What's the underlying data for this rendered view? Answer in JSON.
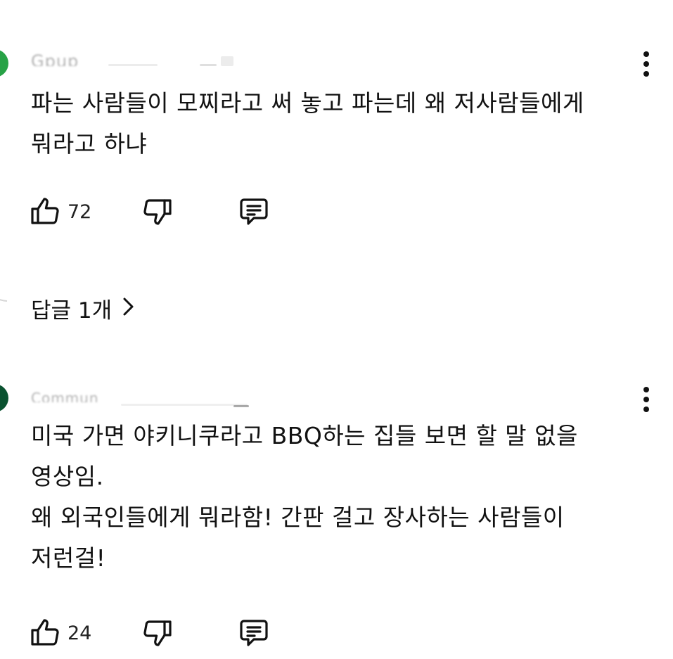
{
  "colors": {
    "avatar_1": "#27a246",
    "avatar_2": "#0a5230",
    "text": "#0f0f0f",
    "muted": "#9a9a9a"
  },
  "comments": [
    {
      "author": "Gpup",
      "text": "파는 사람들이 모찌라고 써 놓고 파는데 왜 저사람들에게\n뭐라고 하냐",
      "likes": "72",
      "icons": {
        "like": "thumbs-up-icon",
        "dislike": "thumbs-down-icon",
        "reply": "comment-icon",
        "menu": "more-vert-icon"
      },
      "replies_label": "답글 1개"
    },
    {
      "author": "Commun",
      "text": "미국 가면 야키니쿠라고 BBQ하는 집들 보면 할 말 없을\n영상임.\n왜 외국인들에게 뭐라함! 간판 걸고 장사하는 사람들이\n저런걸!",
      "likes": "24",
      "icons": {
        "like": "thumbs-up-icon",
        "dislike": "thumbs-down-icon",
        "reply": "comment-icon",
        "menu": "more-vert-icon"
      }
    }
  ]
}
